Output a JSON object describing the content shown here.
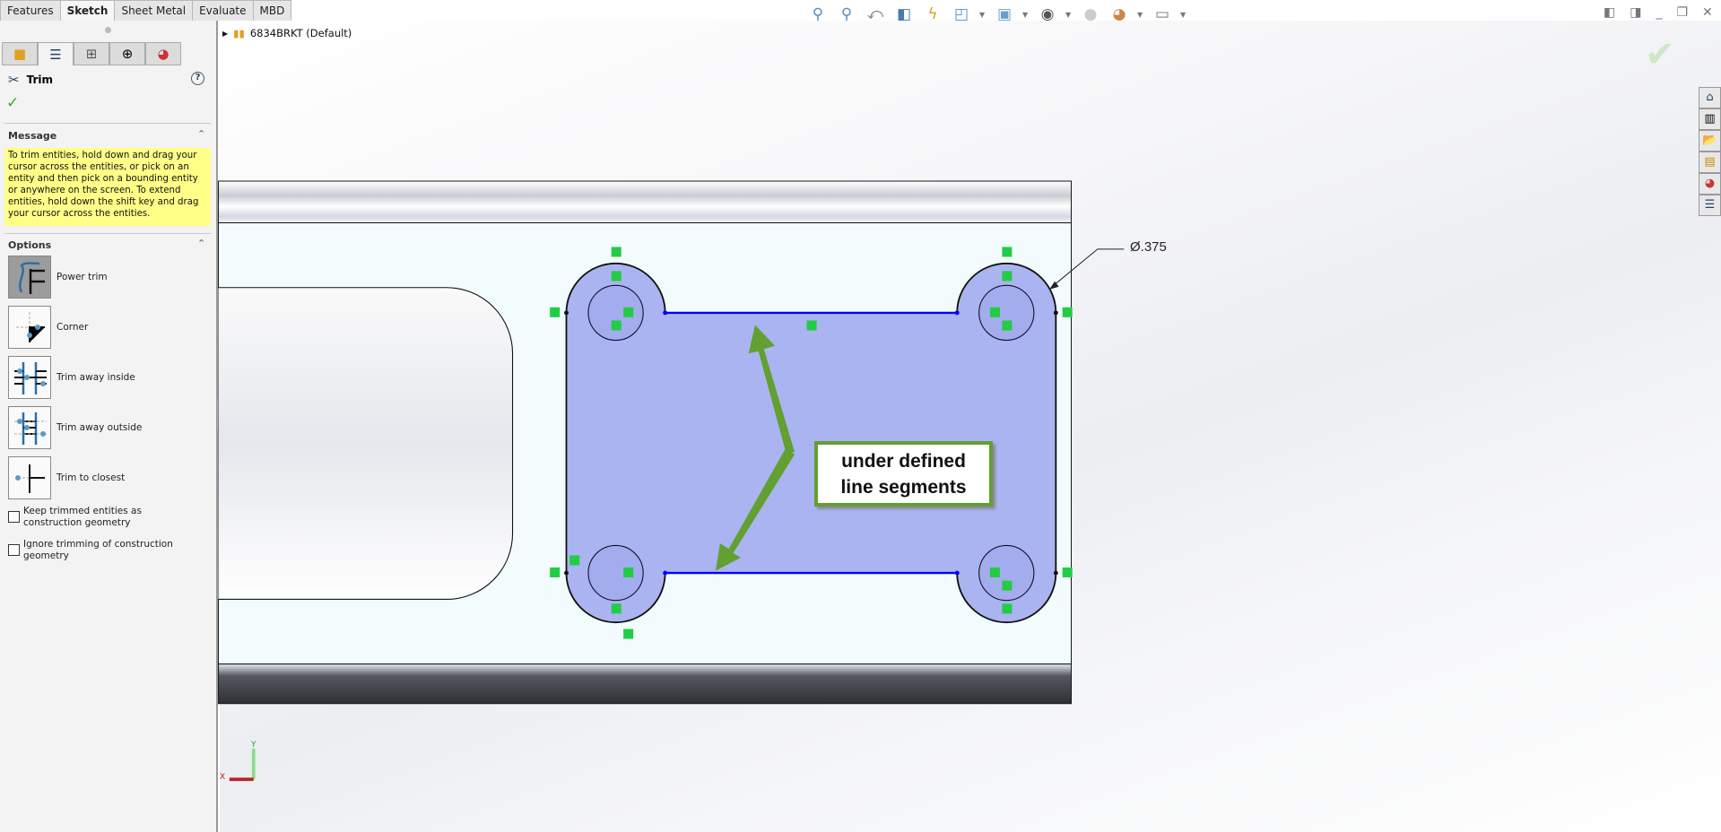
{
  "command_tabs": [
    "Features",
    "Sketch",
    "Sheet Metal",
    "Evaluate",
    "MBD"
  ],
  "active_tab": "Sketch",
  "panel": {
    "title": "Trim",
    "help": "?",
    "ok": "✓",
    "message_header": "Message",
    "message": "To trim entities, hold down and drag your cursor across the entities, or pick on an entity and then pick on a bounding entity or anywhere on the screen.  To extend entities, hold down the shift key and drag your cursor across the entities.",
    "options_header": "Options",
    "options": [
      {
        "label": "Power trim",
        "selected": true
      },
      {
        "label": "Corner",
        "selected": false
      },
      {
        "label": "Trim away inside",
        "selected": false
      },
      {
        "label": "Trim away outside",
        "selected": false
      },
      {
        "label": "Trim to closest",
        "selected": false
      }
    ],
    "checkboxes": [
      {
        "label": "Keep trimmed entities as construction geometry",
        "checked": false
      },
      {
        "label": "Ignore trimming of construction geometry",
        "checked": false
      }
    ]
  },
  "tree": {
    "part": "6834BRKT  (Default)"
  },
  "annotation": {
    "callout": [
      "under defined",
      "line segments"
    ],
    "dimension": "Ø.375"
  },
  "triad": {
    "x": "X",
    "y": "Y"
  },
  "colors": {
    "sketch_fill": "#aab4f0",
    "underdefined_line": "#0000ff",
    "relation_badge": "#22cc44",
    "callout_border": "#62a032",
    "message_bg": "#ffff88"
  }
}
